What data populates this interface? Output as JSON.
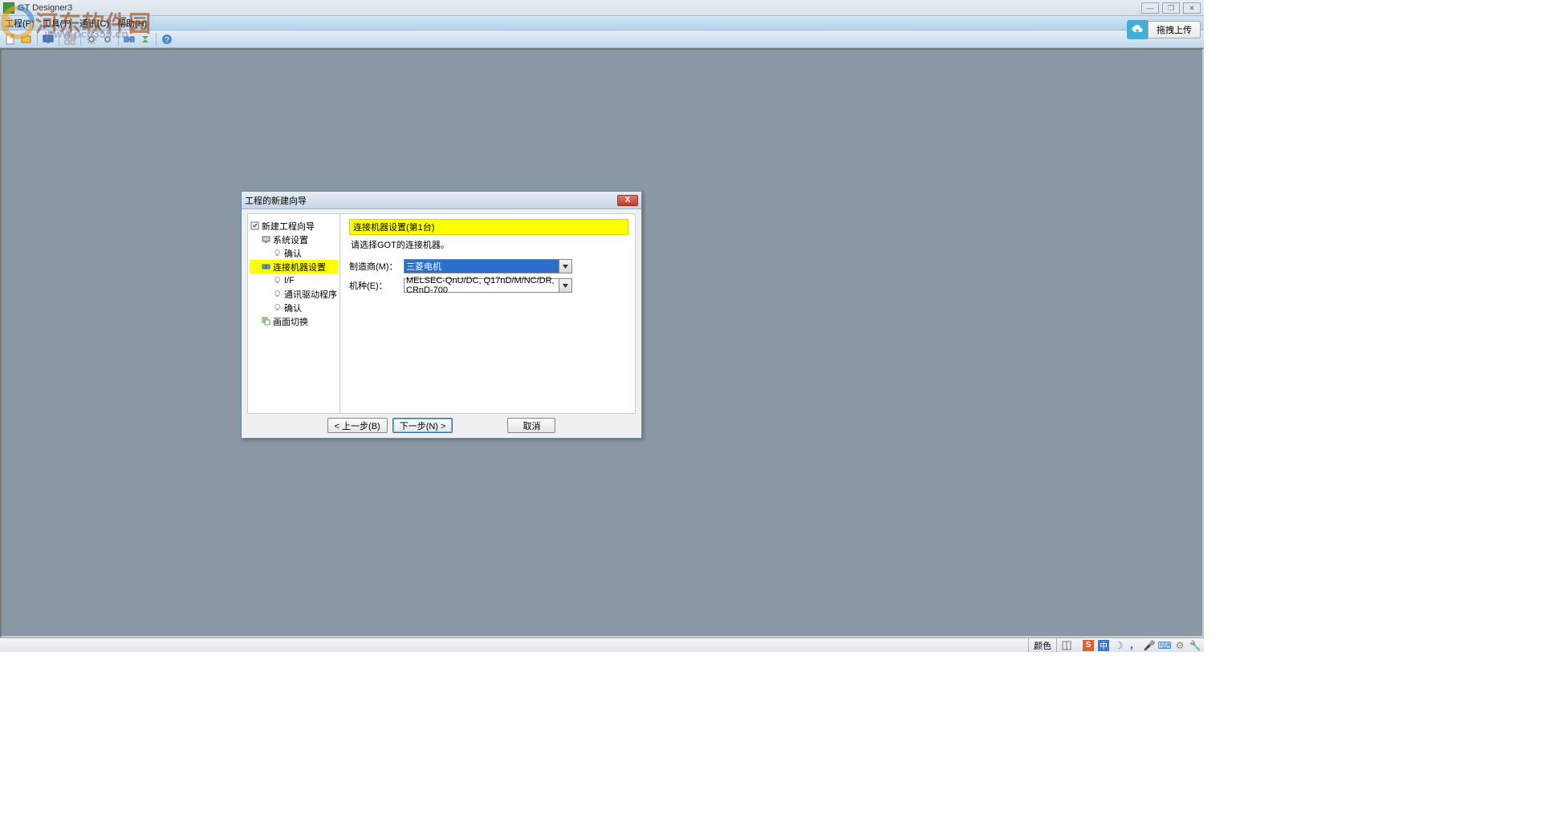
{
  "app": {
    "title": "GT Designer3"
  },
  "menu": {
    "project": "工程(P)",
    "tool": "工具(T)",
    "comm": "通讯(C)",
    "help": "帮助(H)"
  },
  "upload": {
    "label": "拖拽上传"
  },
  "watermark": {
    "main": "河东软件园",
    "url": "www.pc0359.cn"
  },
  "dialog": {
    "title": "工程的新建向导",
    "section_head": "连接机器设置(第1台)",
    "section_desc": "请选择GOT的连接机器。",
    "mfr_label": "制造商(M)：",
    "mfr_value": "三菱电机",
    "type_label": "机种(E)：",
    "type_value": "MELSEC-QnU/DC, Q17nD/M/NC/DR, CRnD-700",
    "back": "< 上一步(B)",
    "next": "下一步(N) >",
    "cancel": "取消"
  },
  "tree": {
    "root": "新建工程向导",
    "sys": "系统设置",
    "sys_confirm": "确认",
    "conn": "连接机器设置",
    "if": "I/F",
    "drv": "通讯驱动程序",
    "conn_confirm": "确认",
    "switch": "画面切换"
  },
  "status": {
    "color": "颜色"
  }
}
